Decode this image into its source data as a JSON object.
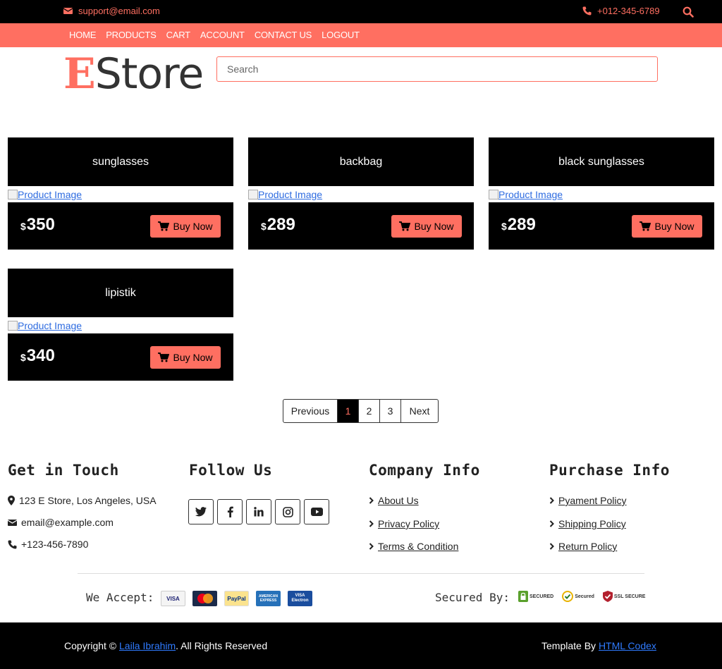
{
  "topbar": {
    "email": "support@email.com",
    "phone": "+012-345-6789"
  },
  "nav": {
    "items": [
      "HOME",
      "PRODUCTS",
      "CART",
      "ACCOUNT",
      "CONTACT US",
      "LOGOUT"
    ]
  },
  "brand": {
    "letter": "E",
    "rest": "Store"
  },
  "search": {
    "placeholder": "Search"
  },
  "products": [
    {
      "name": "sunglasses",
      "image_alt": "Product Image",
      "currency": "$",
      "price": "350",
      "button": "Buy Now"
    },
    {
      "name": "backbag",
      "image_alt": "Product Image",
      "currency": "$",
      "price": "289",
      "button": "Buy Now"
    },
    {
      "name": "black sunglasses",
      "image_alt": "Product Image",
      "currency": "$",
      "price": "289",
      "button": "Buy Now"
    },
    {
      "name": "lipistik",
      "image_alt": "Product Image",
      "currency": "$",
      "price": "340",
      "button": "Buy Now"
    }
  ],
  "pagination": {
    "prev": "Previous",
    "pages": [
      "1",
      "2",
      "3"
    ],
    "next": "Next",
    "active": "1"
  },
  "footer": {
    "touch": {
      "title": "Get in Touch",
      "address": "123 E Store, Los Angeles, USA",
      "email": "email@example.com",
      "phone": "+123-456-7890"
    },
    "follow": {
      "title": "Follow Us"
    },
    "company": {
      "title": "Company Info",
      "links": [
        "About Us",
        "Privacy Policy",
        "Terms & Condition"
      ]
    },
    "purchase": {
      "title": "Purchase Info",
      "links": [
        "Pyament Policy",
        "Shipping Policy",
        "Return Policy"
      ]
    },
    "accept_label": "We Accept:",
    "cards": [
      "VISA",
      "MasterCard",
      "PayPal",
      "AMERICAN EXPRESS",
      "VISA Electron"
    ],
    "secured_label": "Secured By:",
    "seals": [
      "SECURED",
      "Secured",
      "SSL SECURE"
    ]
  },
  "bottom": {
    "copy_prefix": "Copyright © ",
    "author": "Laila Ibrahim",
    "copy_suffix": ". All Rights Reserved",
    "template_prefix": "Template By ",
    "template_link": "HTML Codex"
  },
  "colors": {
    "accent": "#ff6f61",
    "dark": "#000000",
    "link": "#2f7bff"
  }
}
